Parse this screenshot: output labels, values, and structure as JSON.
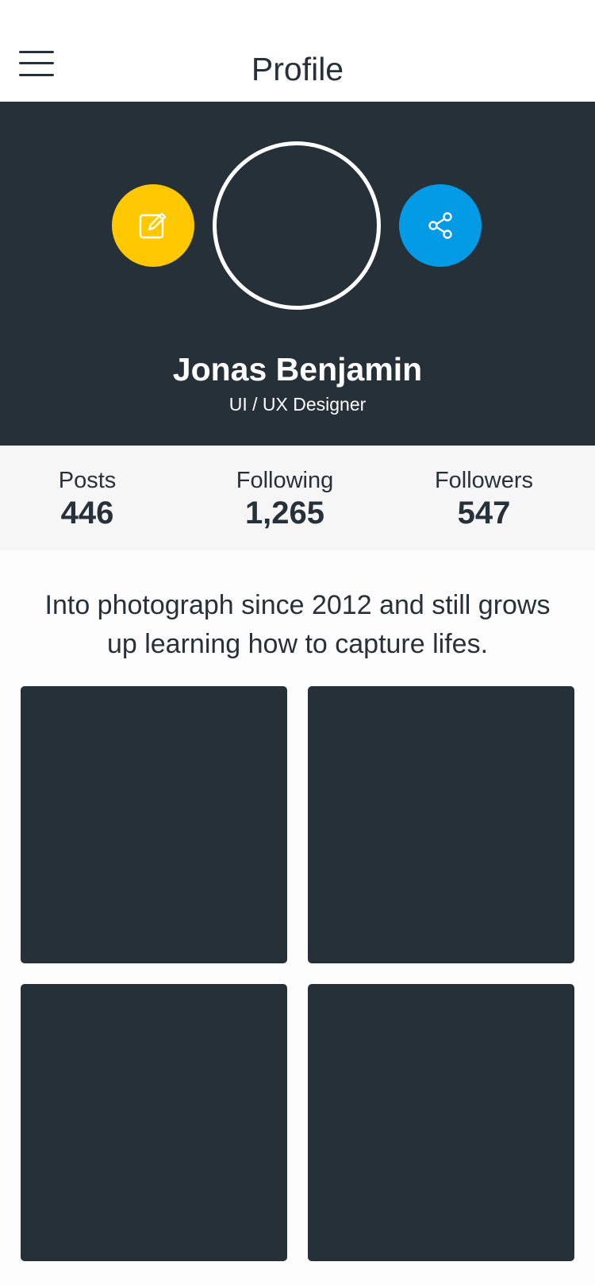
{
  "header": {
    "title": "Profile",
    "menu_icon": "hamburger-menu-icon"
  },
  "profile": {
    "name": "Jonas Benjamin",
    "role": "UI / UX Designer",
    "edit_icon": "edit-icon",
    "share_icon": "share-icon",
    "colors": {
      "hero_background": "#263038",
      "edit_button": "#FFC800",
      "share_button": "#039BE5"
    }
  },
  "stats": [
    {
      "label": "Posts",
      "value": "446"
    },
    {
      "label": "Following",
      "value": "1,265"
    },
    {
      "label": "Followers",
      "value": "547"
    }
  ],
  "bio": "Into photograph since 2012 and still grows up learning how to capture lifes.",
  "gallery": {
    "count": 4,
    "tile_color": "#263038"
  }
}
